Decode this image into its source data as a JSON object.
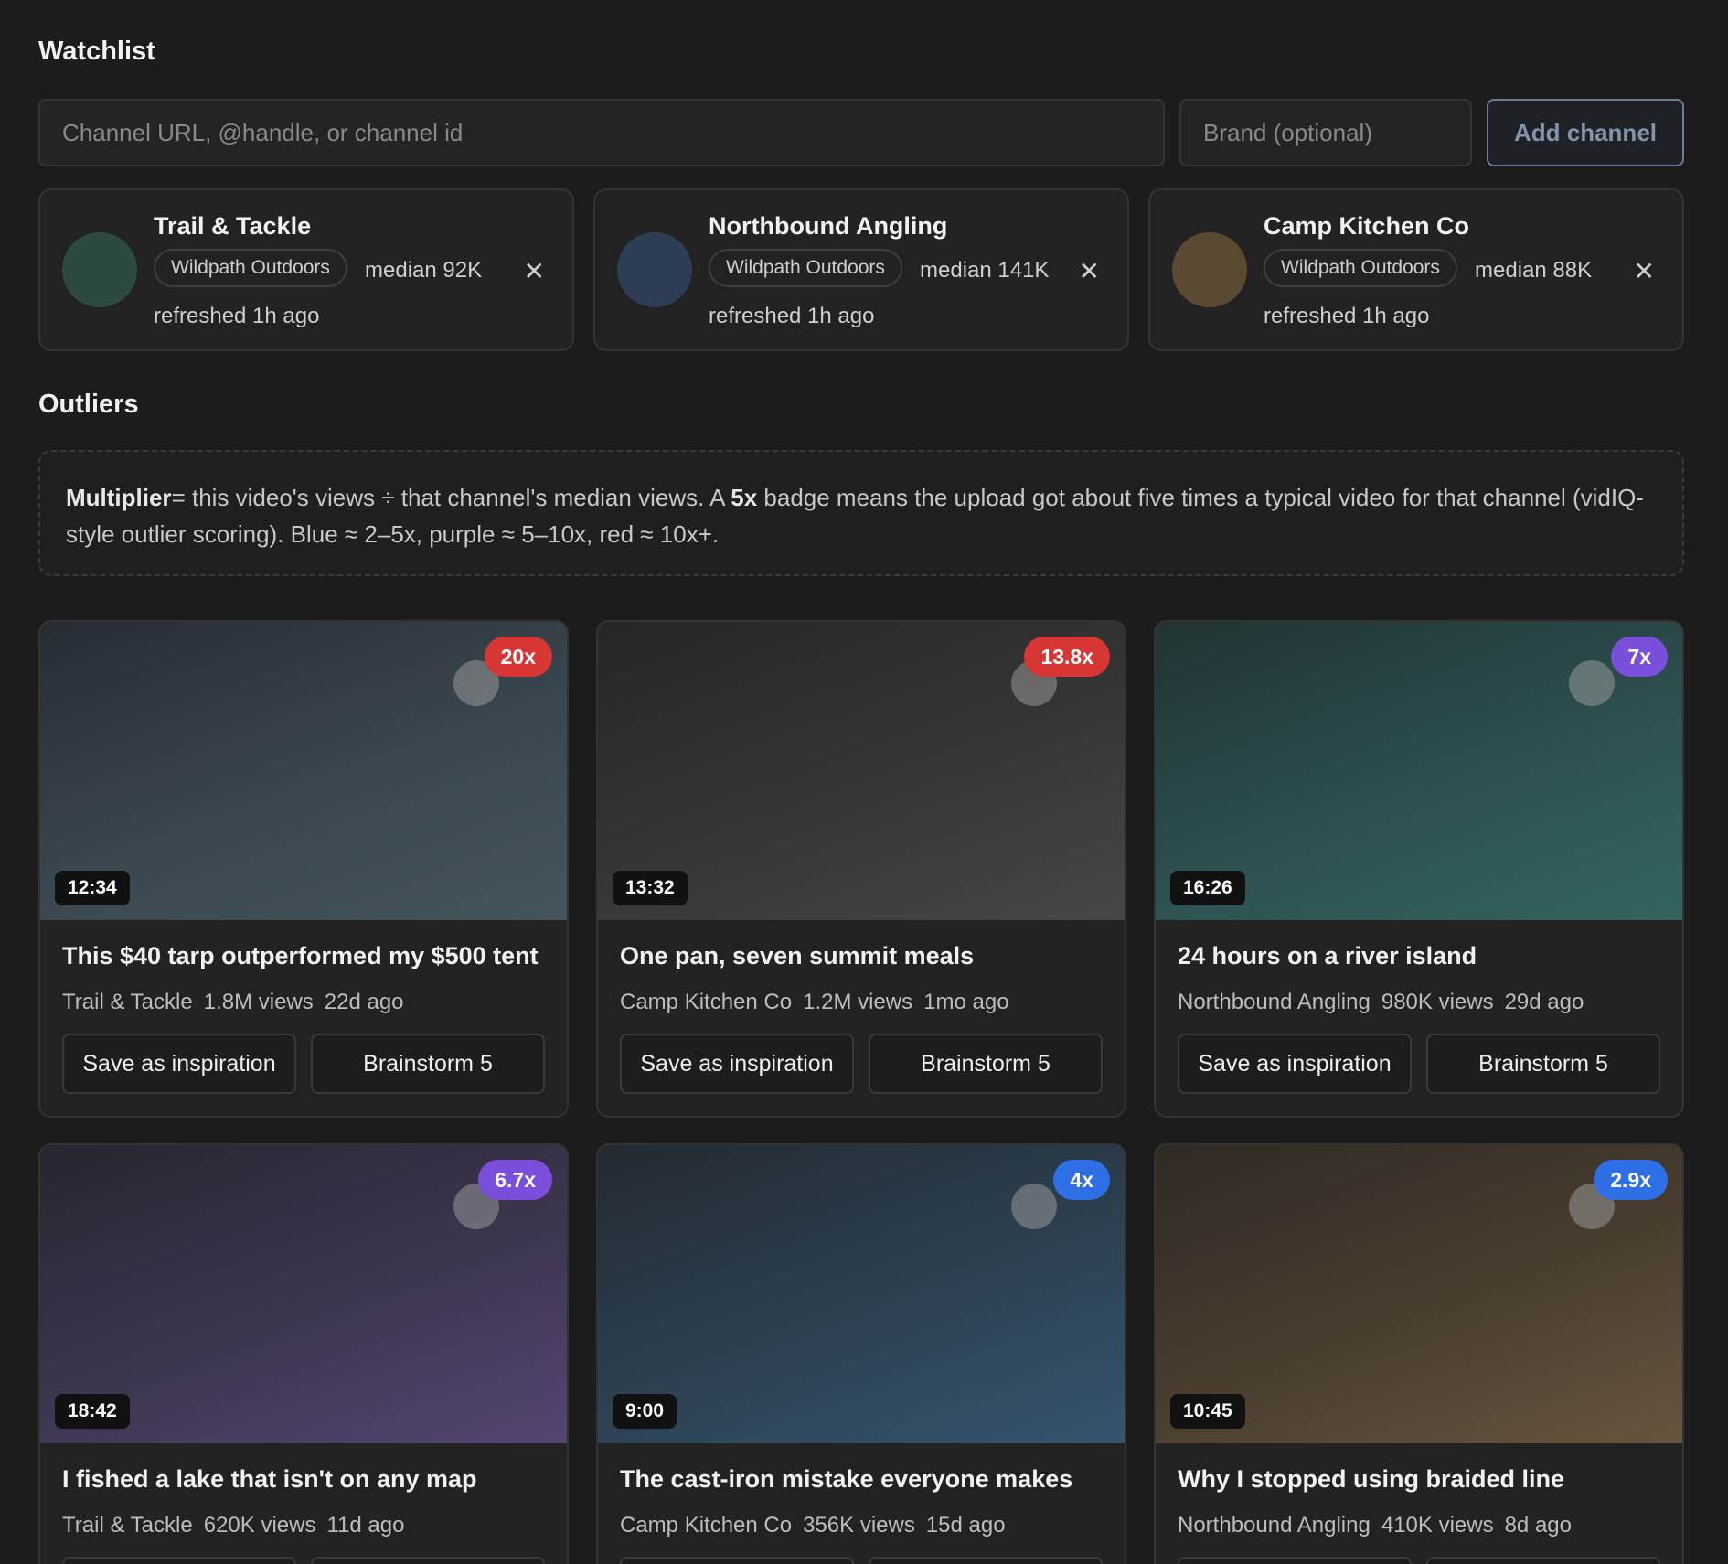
{
  "watchlist": {
    "title": "Watchlist",
    "url_placeholder": "Channel URL, @handle, or channel id",
    "brand_placeholder": "Brand (optional)",
    "add_label": "Add channel",
    "channels": [
      {
        "name": "Trail & Tackle",
        "brand": "Wildpath Outdoors",
        "median": "median 92K",
        "refreshed": "refreshed 1h ago",
        "avatar_color": "#2c4a42"
      },
      {
        "name": "Northbound Angling",
        "brand": "Wildpath Outdoors",
        "median": "median 141K",
        "refreshed": "refreshed 1h ago",
        "avatar_color": "#2d3d55"
      },
      {
        "name": "Camp Kitchen Co",
        "brand": "Wildpath Outdoors",
        "median": "median 88K",
        "refreshed": "refreshed 1h ago",
        "avatar_color": "#5a4a32"
      }
    ]
  },
  "outliers": {
    "title": "Outliers",
    "info": {
      "term": "Multiplier",
      "part1": "= this video's views ÷ that channel's median views. A ",
      "example": "5x",
      "part2": " badge means the upload got about five times a typical video for that channel (vidIQ-style outlier scoring). Blue ≈ 2–5x, purple ≈ 5–10x, red ≈ 10x+."
    },
    "save_label": "Save as inspiration",
    "brainstorm_label": "Brainstorm 5",
    "videos": [
      {
        "title": "This $40 tarp outperformed my $500 tent",
        "channel": "Trail & Tackle",
        "views": "1.8M views",
        "age": "22d ago",
        "duration": "12:34",
        "multiplier": "20x",
        "tier": "red"
      },
      {
        "title": "One pan, seven summit meals",
        "channel": "Camp Kitchen Co",
        "views": "1.2M views",
        "age": "1mo ago",
        "duration": "13:32",
        "multiplier": "13.8x",
        "tier": "red"
      },
      {
        "title": "24 hours on a river island",
        "channel": "Northbound Angling",
        "views": "980K views",
        "age": "29d ago",
        "duration": "16:26",
        "multiplier": "7x",
        "tier": "purple"
      },
      {
        "title": "I fished a lake that isn't on any map",
        "channel": "Trail & Tackle",
        "views": "620K views",
        "age": "11d ago",
        "duration": "18:42",
        "multiplier": "6.7x",
        "tier": "purple"
      },
      {
        "title": "The cast-iron mistake everyone makes",
        "channel": "Camp Kitchen Co",
        "views": "356K views",
        "age": "15d ago",
        "duration": "9:00",
        "multiplier": "4x",
        "tier": "blue"
      },
      {
        "title": "Why I stopped using braided line",
        "channel": "Northbound Angling",
        "views": "410K views",
        "age": "8d ago",
        "duration": "10:45",
        "multiplier": "2.9x",
        "tier": "blue"
      }
    ]
  },
  "colors": {
    "red": "#d83535",
    "purple": "#7a4fdc",
    "blue": "#2f6fe6",
    "background": "#1c1c1c"
  }
}
